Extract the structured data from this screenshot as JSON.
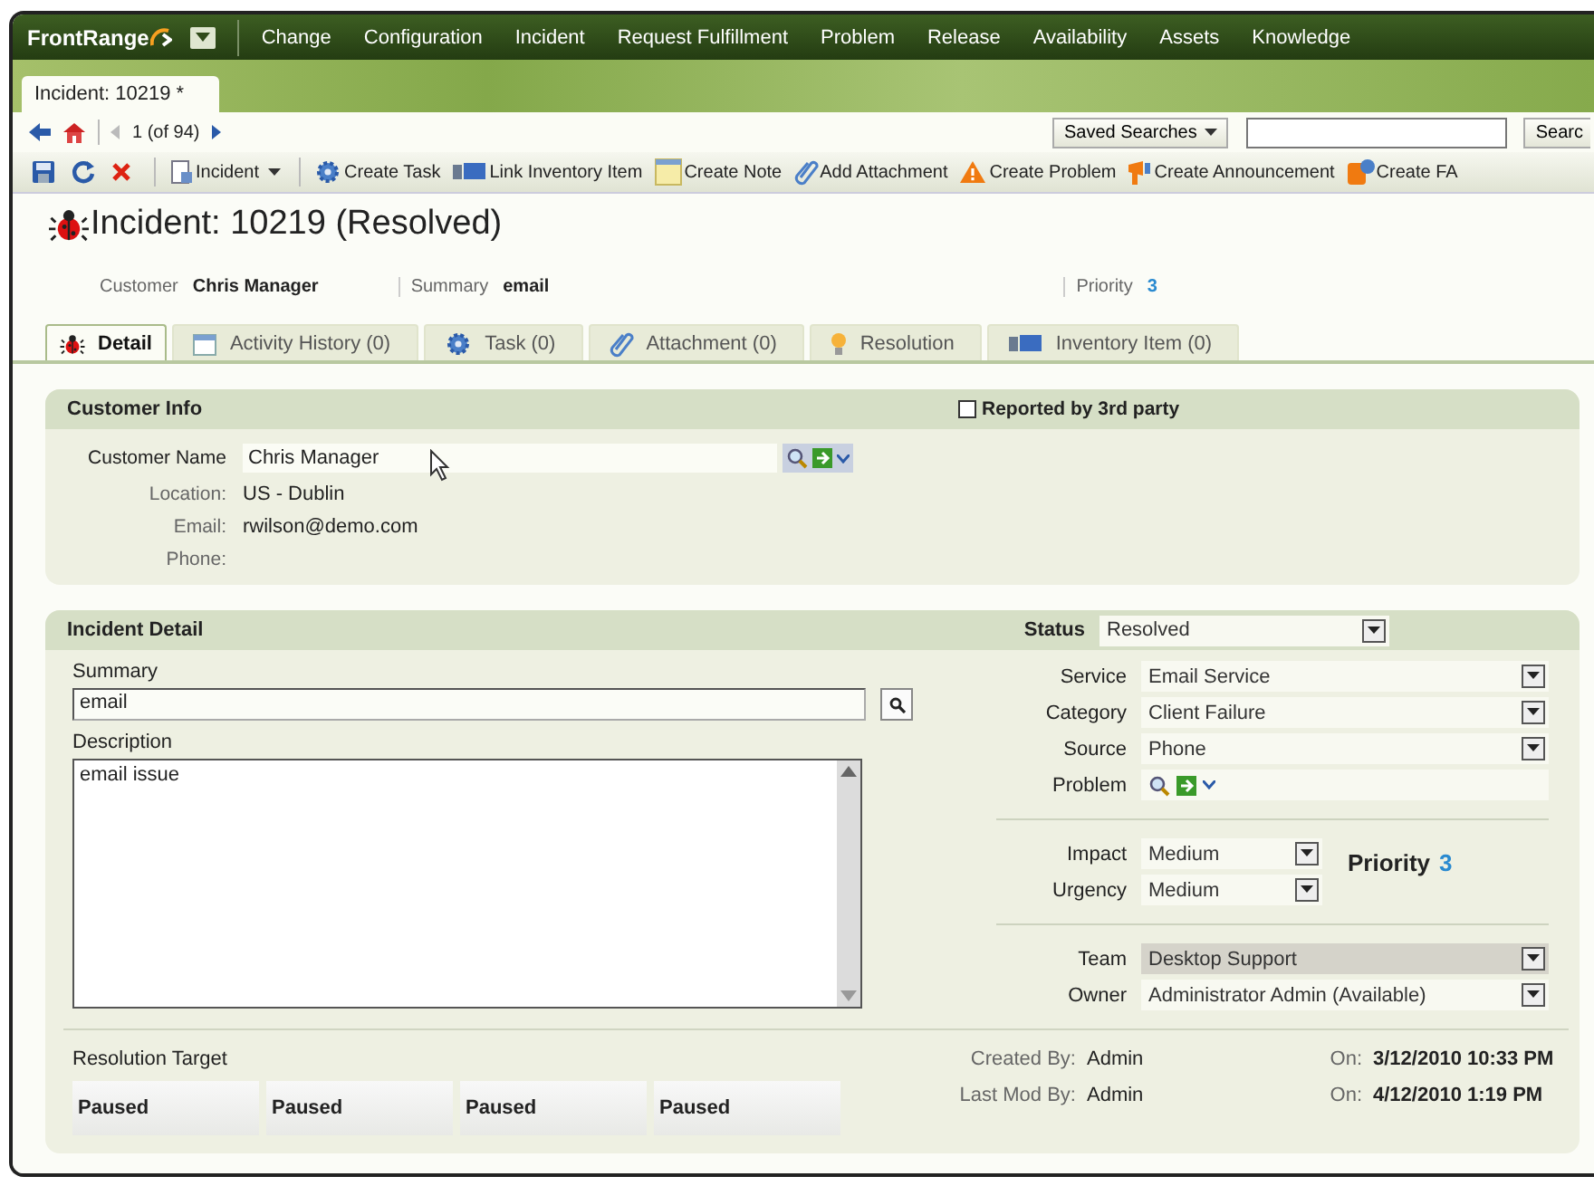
{
  "app": {
    "logo": "FrontRange",
    "menu": [
      {
        "label": "Change"
      },
      {
        "label": "Configuration"
      },
      {
        "label": "Incident"
      },
      {
        "label": "Request Fulfillment"
      },
      {
        "label": "Problem"
      },
      {
        "label": "Release"
      },
      {
        "label": "Availability"
      },
      {
        "label": "Assets"
      },
      {
        "label": "Knowledge"
      }
    ]
  },
  "document_tabs": [
    {
      "label": "Incident: 10219 *",
      "selected": true
    }
  ],
  "navigation": {
    "position": "1 (of 94)",
    "saved_searches": "Saved Searches",
    "search_button": "Searc"
  },
  "toolbar": [
    {
      "kind": "icon"
    },
    {
      "kind": "icon"
    },
    {
      "kind": "icon"
    },
    {
      "kind": "menu",
      "label": "Incident"
    },
    {
      "kind": "button",
      "label": "Create Task"
    },
    {
      "kind": "button",
      "label": "Link Inventory Item"
    },
    {
      "kind": "button",
      "label": "Create Note"
    },
    {
      "kind": "button",
      "label": "Add Attachment"
    },
    {
      "kind": "button",
      "label": "Create Problem"
    },
    {
      "kind": "button",
      "label": "Create Announcement"
    },
    {
      "kind": "button",
      "label": "Create FA"
    }
  ],
  "title": "Incident: 10219 (Resolved)",
  "summary_bar": [
    {
      "label": "Customer",
      "value": "Chris Manager"
    },
    {
      "label": "Summary",
      "value": "email"
    },
    {
      "label": "Priority",
      "value": "3"
    }
  ],
  "tabs": [
    {
      "label": "Detail",
      "selected": true
    },
    {
      "label": "Activity History (0)",
      "selected": false
    },
    {
      "label": "Task (0)",
      "selected": false
    },
    {
      "label": "Attachment (0)",
      "selected": false
    },
    {
      "label": "Resolution",
      "selected": false
    },
    {
      "label": "Inventory Item (0)",
      "selected": false
    }
  ],
  "customer_info": {
    "title": "Customer Info",
    "reported_by_third_party": {
      "label": "Reported by 3rd party",
      "checked": false
    },
    "customer_name": {
      "label": "Customer Name",
      "value": "Chris Manager"
    },
    "fields": [
      {
        "label": "Location:",
        "value": "US - Dublin"
      },
      {
        "label": "Email:",
        "value": "rwilson@demo.com"
      },
      {
        "label": "Phone:"
      }
    ]
  },
  "incident_detail": {
    "title": "Incident Detail",
    "status": {
      "label": "Status",
      "value": "Resolved"
    },
    "summary": {
      "label": "Summary",
      "value": "email"
    },
    "description": {
      "label": "Description",
      "value": "email issue"
    },
    "classification": [
      {
        "kind": "select",
        "label": "Service",
        "value": "Email Service"
      },
      {
        "kind": "select",
        "label": "Category",
        "value": "Client Failure"
      },
      {
        "kind": "select",
        "label": "Source",
        "value": "Phone"
      },
      {
        "kind": "lookup",
        "label": "Problem"
      }
    ],
    "impact": {
      "label": "Impact",
      "value": "Medium"
    },
    "urgency": {
      "label": "Urgency",
      "value": "Medium"
    },
    "priority": {
      "label": "Priority",
      "value": "3"
    },
    "assignment": [
      {
        "label": "Team",
        "value": "Desktop Support",
        "disabled": true
      },
      {
        "label": "Owner",
        "value": "Administrator Admin (Available)",
        "disabled": false
      }
    ],
    "resolution_target": {
      "label": "Resolution Target",
      "timers": [
        "Paused",
        "Paused",
        "Paused",
        "Paused"
      ]
    },
    "audit": [
      {
        "label": "Created By:",
        "value": "Admin",
        "on_label": "On:",
        "date": "3/12/2010 10:33 PM"
      },
      {
        "label": "Last Mod By:",
        "value": "Admin",
        "on_label": "On:",
        "date": "4/12/2010 1:19 PM"
      }
    ]
  }
}
